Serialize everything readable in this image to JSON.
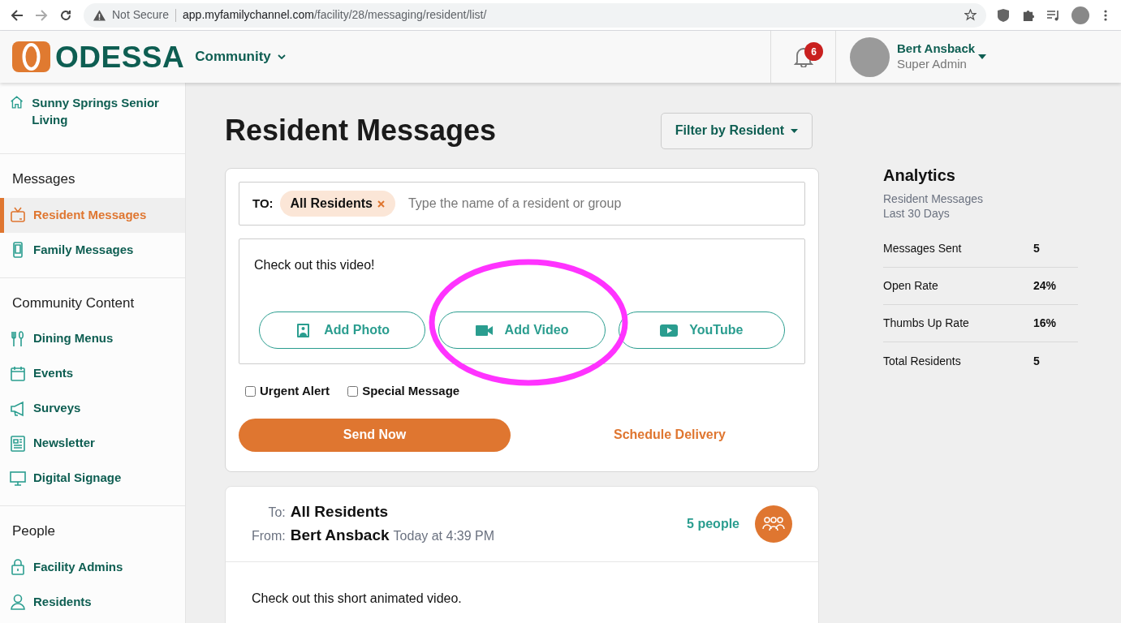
{
  "browser": {
    "security": "Not Secure",
    "url_host": "app.myfamilychannel.com",
    "url_path": "/facility/28/messaging/resident/list/"
  },
  "header": {
    "brand": "ODESSA",
    "menu": "Community",
    "notifications": "6",
    "user": {
      "name": "Bert Ansback",
      "role": "Super Admin"
    }
  },
  "sidebar": {
    "facility": "Sunny Springs Senior Living",
    "sections": [
      {
        "heading": "Messages",
        "items": [
          {
            "label": "Resident Messages",
            "selected": true
          },
          {
            "label": "Family Messages",
            "selected": false
          }
        ]
      },
      {
        "heading": "Community Content",
        "items": [
          {
            "label": "Dining Menus",
            "selected": false
          },
          {
            "label": "Events",
            "selected": false
          },
          {
            "label": "Surveys",
            "selected": false
          },
          {
            "label": "Newsletter",
            "selected": false
          },
          {
            "label": "Digital Signage",
            "selected": false
          }
        ]
      },
      {
        "heading": "People",
        "items": [
          {
            "label": "Facility Admins",
            "selected": false
          },
          {
            "label": "Residents",
            "selected": false
          }
        ]
      }
    ]
  },
  "page": {
    "title": "Resident Messages",
    "filter": "Filter by Resident"
  },
  "composer": {
    "to_label": "TO:",
    "recipients": [
      "All Residents"
    ],
    "recipient_placeholder": "Type the name of a resident or group",
    "message": "Check out this video!",
    "attachments": [
      "Add Photo",
      "Add Video",
      "YouTube"
    ],
    "options": [
      {
        "label": "Urgent Alert",
        "checked": false
      },
      {
        "label": "Special Message",
        "checked": false
      }
    ],
    "send": "Send Now",
    "schedule": "Schedule Delivery"
  },
  "annotation": {
    "kind": "ellipse"
  },
  "messages": [
    {
      "to_label": "To:",
      "to": "All Residents",
      "from_label": "From:",
      "from": "Bert Ansback",
      "time": "Today at 4:39 PM",
      "audience": "5 people",
      "body": "Check out this short animated video."
    }
  ],
  "analytics": {
    "title": "Analytics",
    "subtitle": "Resident Messages",
    "period": "Last 30 Days",
    "rows": [
      {
        "label": "Messages Sent",
        "value": "5"
      },
      {
        "label": "Open Rate",
        "value": "24%"
      },
      {
        "label": "Thumbs Up Rate",
        "value": "16%"
      },
      {
        "label": "Total Residents",
        "value": "5"
      }
    ]
  }
}
